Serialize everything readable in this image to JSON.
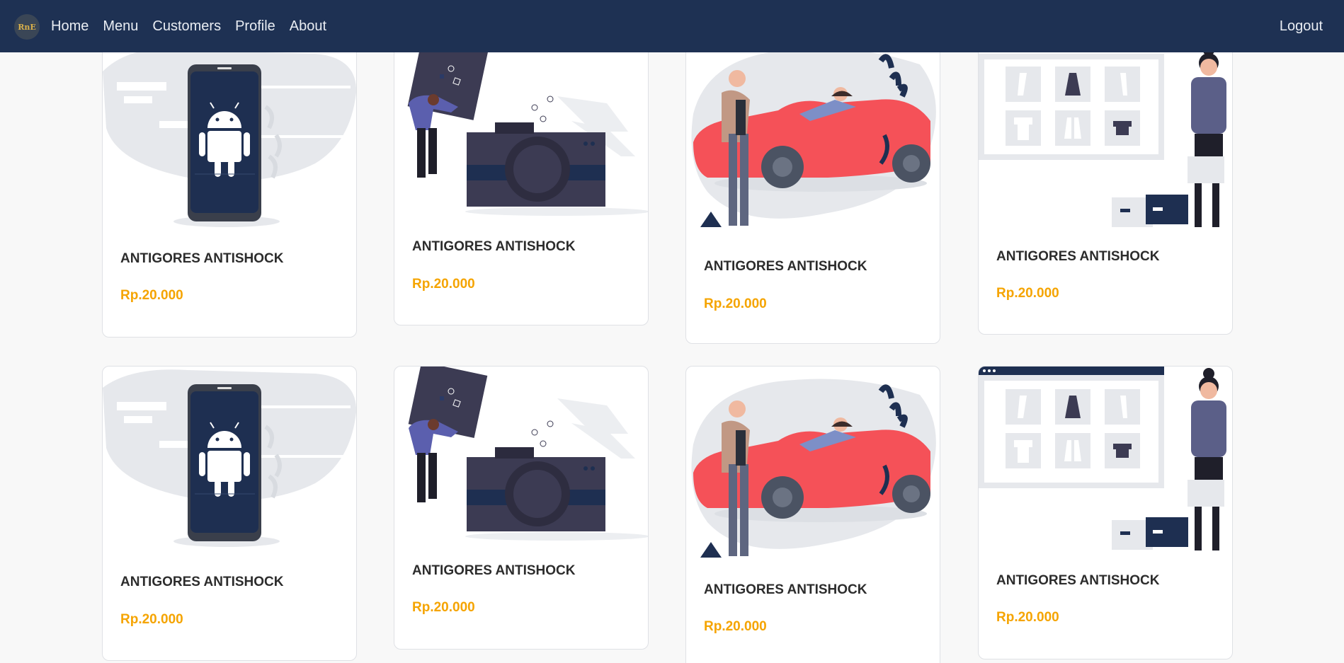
{
  "nav": {
    "logo_text": "RnE",
    "links": [
      "Home",
      "Menu",
      "Customers",
      "Profile",
      "About"
    ],
    "logout": "Logout"
  },
  "colors": {
    "navbar": "#1e3153",
    "price": "#f5a400",
    "page_bg": "#f8f8f8"
  },
  "products": [
    {
      "title": "ANTIGORES ANTISHOCK",
      "price": "Rp.20.000",
      "illustration": "android-phone-illustration"
    },
    {
      "title": "ANTIGORES ANTISHOCK",
      "price": "Rp.20.000",
      "illustration": "camera-illustration"
    },
    {
      "title": "ANTIGORES ANTISHOCK",
      "price": "Rp.20.000",
      "illustration": "red-car-illustration"
    },
    {
      "title": "ANTIGORES ANTISHOCK",
      "price": "Rp.20.000",
      "illustration": "clothing-shop-illustration"
    },
    {
      "title": "ANTIGORES ANTISHOCK",
      "price": "Rp.20.000",
      "illustration": "android-phone-illustration"
    },
    {
      "title": "ANTIGORES ANTISHOCK",
      "price": "Rp.20.000",
      "illustration": "camera-illustration"
    },
    {
      "title": "ANTIGORES ANTISHOCK",
      "price": "Rp.20.000",
      "illustration": "red-car-illustration"
    },
    {
      "title": "ANTIGORES ANTISHOCK",
      "price": "Rp.20.000",
      "illustration": "clothing-shop-illustration"
    }
  ]
}
